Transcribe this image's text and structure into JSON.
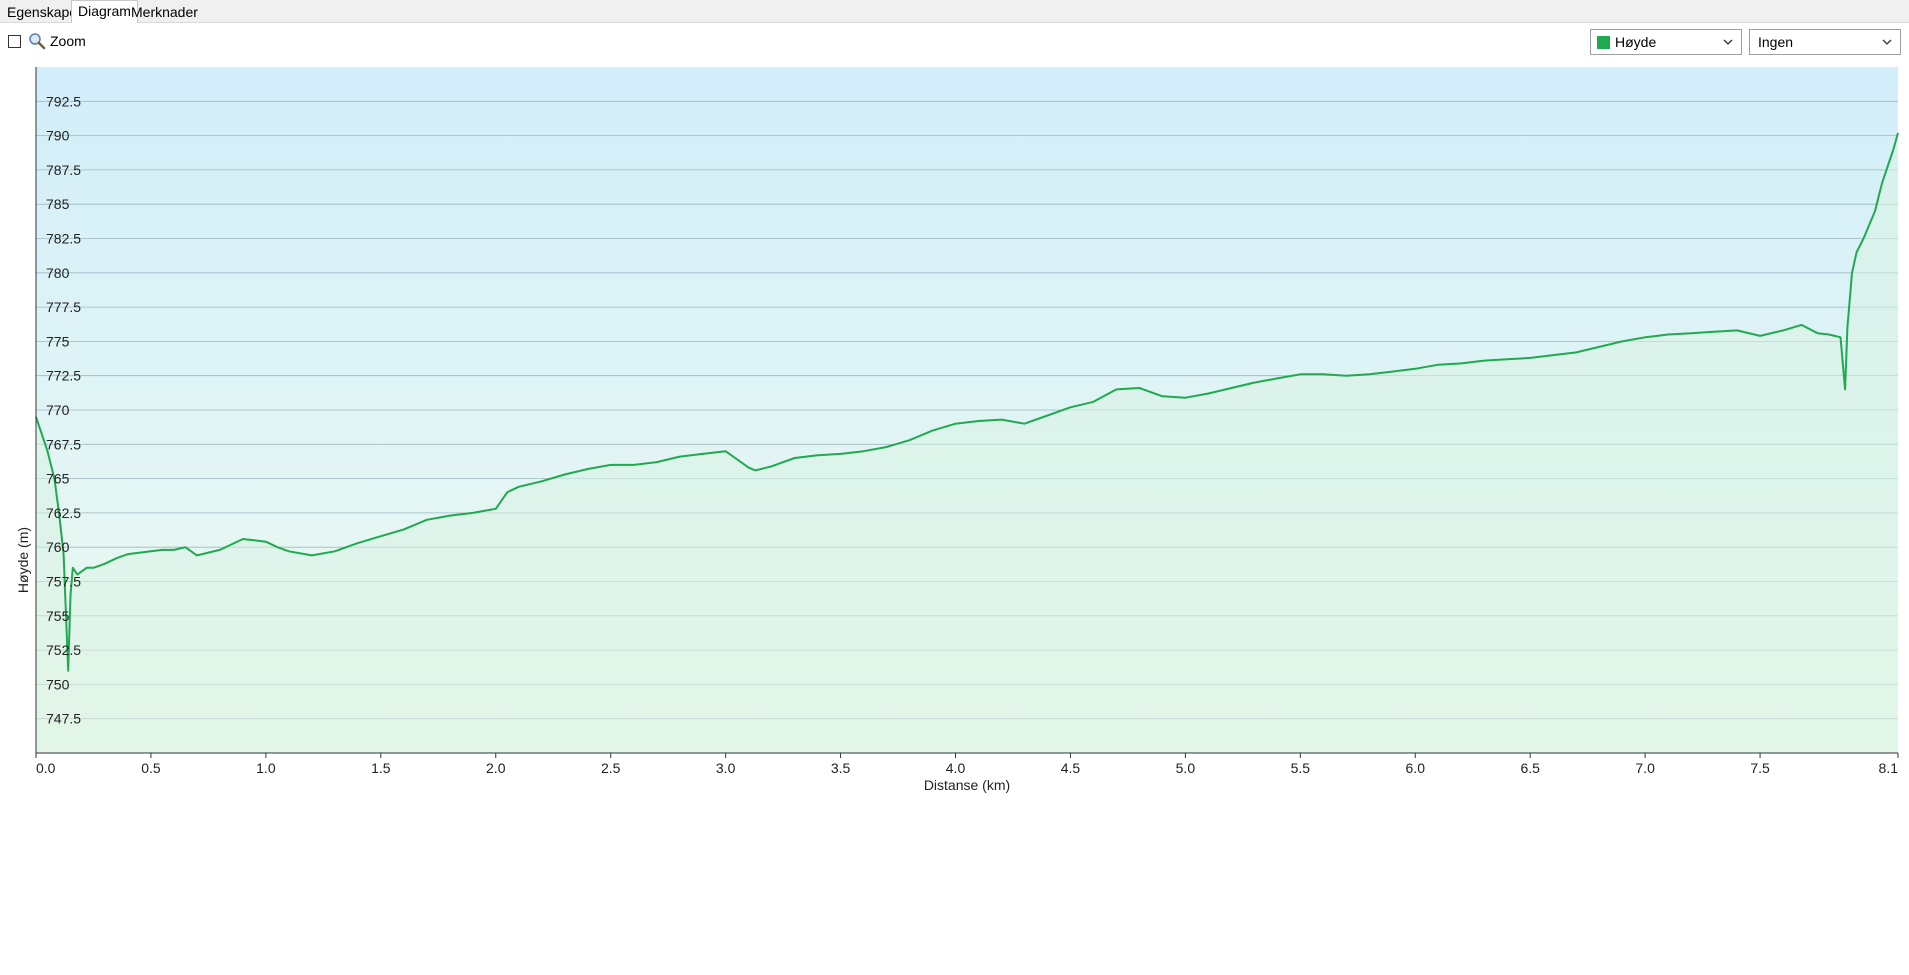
{
  "tabs": [
    {
      "label": "Egenskaper",
      "active": false
    },
    {
      "label": "Diagram",
      "active": true
    },
    {
      "label": "Merknader",
      "active": false
    }
  ],
  "toolbar": {
    "zoom_label": "Zoom",
    "zoom_checked": false,
    "series_select": {
      "value": "Høyde",
      "swatch_color": "#1faa4f"
    },
    "compare_select": {
      "value": "Ingen"
    }
  },
  "chart_data": {
    "type": "area",
    "xlabel": "Distanse  (km)",
    "ylabel": "Høyde (m)",
    "xlim": [
      0,
      8.1
    ],
    "ylim": [
      745,
      795
    ],
    "x_ticks": [
      "0.0",
      "0.5",
      "1.0",
      "1.5",
      "2.0",
      "2.5",
      "3.0",
      "3.5",
      "4.0",
      "4.5",
      "5.0",
      "5.5",
      "6.0",
      "6.5",
      "7.0",
      "7.5",
      "8.1"
    ],
    "x_tick_values": [
      0,
      0.5,
      1.0,
      1.5,
      2.0,
      2.5,
      3.0,
      3.5,
      4.0,
      4.5,
      5.0,
      5.5,
      6.0,
      6.5,
      7.0,
      7.5,
      8.1
    ],
    "y_ticks": [
      "747.5",
      "750",
      "752.5",
      "755",
      "757.5",
      "760",
      "762.5",
      "765",
      "767.5",
      "770",
      "772.5",
      "775",
      "777.5",
      "780",
      "782.5",
      "785",
      "787.5",
      "790",
      "792.5"
    ],
    "y_tick_values": [
      747.5,
      750,
      752.5,
      755,
      757.5,
      760,
      762.5,
      765,
      767.5,
      770,
      772.5,
      775,
      777.5,
      780,
      782.5,
      785,
      787.5,
      790,
      792.5
    ],
    "grid": true,
    "colors": {
      "line": "#1faa4f",
      "bg_top": "#d2eefa",
      "bg_bottom": "#eefaf0",
      "fill": "#d8f3e2"
    },
    "series": [
      {
        "x": [
          0.0,
          0.02,
          0.05,
          0.08,
          0.1,
          0.12,
          0.14,
          0.15,
          0.16,
          0.18,
          0.22,
          0.25,
          0.3,
          0.35,
          0.4,
          0.5,
          0.55,
          0.6,
          0.65,
          0.7,
          0.8,
          0.9,
          1.0,
          1.05,
          1.1,
          1.2,
          1.3,
          1.4,
          1.5,
          1.6,
          1.7,
          1.8,
          1.9,
          2.0,
          2.05,
          2.1,
          2.2,
          2.3,
          2.4,
          2.5,
          2.6,
          2.7,
          2.8,
          2.9,
          3.0,
          3.1,
          3.13,
          3.2,
          3.3,
          3.4,
          3.5,
          3.6,
          3.7,
          3.8,
          3.9,
          4.0,
          4.1,
          4.2,
          4.3,
          4.4,
          4.5,
          4.6,
          4.7,
          4.8,
          4.9,
          5.0,
          5.1,
          5.2,
          5.3,
          5.4,
          5.5,
          5.6,
          5.7,
          5.8,
          5.9,
          6.0,
          6.1,
          6.2,
          6.3,
          6.4,
          6.5,
          6.6,
          6.7,
          6.8,
          6.9,
          7.0,
          7.1,
          7.2,
          7.3,
          7.4,
          7.5,
          7.6,
          7.68,
          7.75,
          7.8,
          7.85,
          7.87,
          7.88,
          7.9,
          7.92,
          7.95,
          8.0,
          8.03,
          8.06,
          8.08,
          8.1
        ],
        "y": [
          769.5,
          768.5,
          767.0,
          765.0,
          762.5,
          759.5,
          751.0,
          756.5,
          758.5,
          758.0,
          758.5,
          758.5,
          758.8,
          759.2,
          759.5,
          759.7,
          759.8,
          759.8,
          760.0,
          759.4,
          759.8,
          760.6,
          760.4,
          760.0,
          759.7,
          759.4,
          759.7,
          760.3,
          760.8,
          761.3,
          762.0,
          762.3,
          762.5,
          762.8,
          764.0,
          764.4,
          764.8,
          765.3,
          765.7,
          766.0,
          766.0,
          766.2,
          766.6,
          766.8,
          767.0,
          765.8,
          765.6,
          765.9,
          766.5,
          766.7,
          766.8,
          767.0,
          767.3,
          767.8,
          768.5,
          769.0,
          769.2,
          769.3,
          769.0,
          769.6,
          770.2,
          770.6,
          771.5,
          771.6,
          771.0,
          770.9,
          771.2,
          771.6,
          772.0,
          772.3,
          772.6,
          772.6,
          772.5,
          772.6,
          772.8,
          773.0,
          773.3,
          773.4,
          773.6,
          773.7,
          773.8,
          774.0,
          774.2,
          774.6,
          775.0,
          775.3,
          775.5,
          775.6,
          775.7,
          775.8,
          775.4,
          775.8,
          776.2,
          775.6,
          775.5,
          775.3,
          771.5,
          776.0,
          780.0,
          781.5,
          782.5,
          784.5,
          786.5,
          788.0,
          789.0,
          790.2
        ]
      }
    ]
  }
}
